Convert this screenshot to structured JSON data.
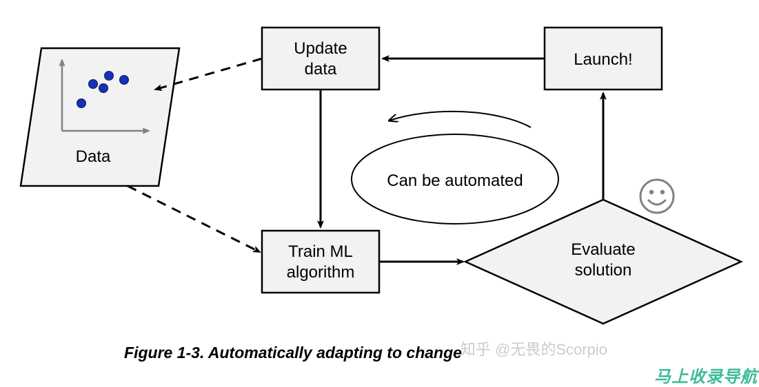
{
  "nodes": {
    "data": "Data",
    "update_line1": "Update",
    "update_line2": "data",
    "launch": "Launch!",
    "automated": "Can be automated",
    "train_line1": "Train ML",
    "train_line2": "algorithm",
    "evaluate_line1": "Evaluate",
    "evaluate_line2": "solution"
  },
  "caption": "Figure 1-3. Automatically adapting to change",
  "watermarks": {
    "w1": "知乎 @无畏的Scorpio",
    "w2": "马上收录导航"
  }
}
